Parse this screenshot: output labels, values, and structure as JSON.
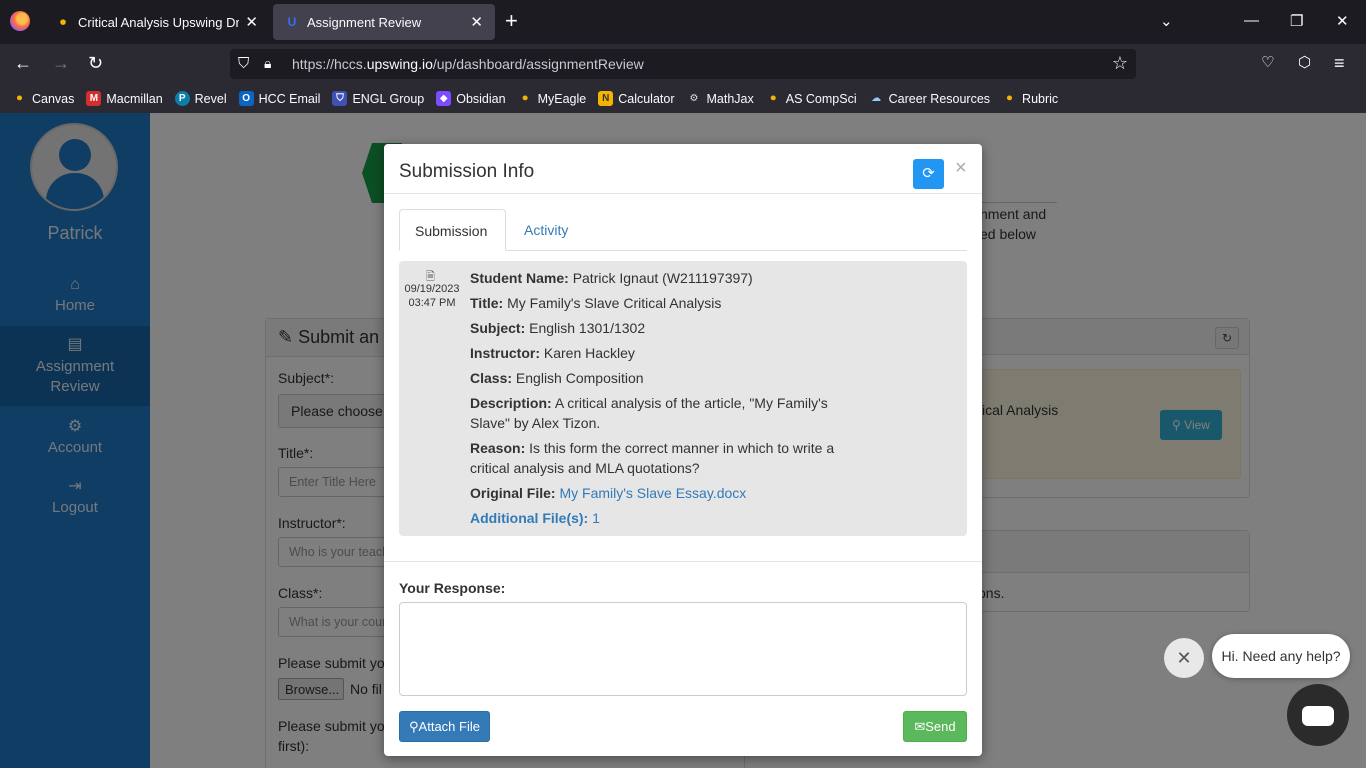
{
  "browser": {
    "tabs": [
      {
        "title": "Critical Analysis Upswing Drafts",
        "active": false
      },
      {
        "title": "Assignment Review",
        "active": true
      }
    ],
    "url_prefix": "https://hccs.",
    "url_domain": "upswing.io",
    "url_path": "/up/dashboard/assignmentReview",
    "bookmarks": [
      "Canvas",
      "Macmillan",
      "Revel",
      "HCC Email",
      "ENGL Group",
      "Obsidian",
      "MyEagle",
      "Calculator",
      "MathJax",
      "AS CompSci",
      "Career Resources",
      "Rubric"
    ]
  },
  "sidebar": {
    "username": "Patrick",
    "items": [
      {
        "label": "Home",
        "icon": "home-icon"
      },
      {
        "label": "Assignment Review",
        "icon": "file-icon",
        "active": true
      },
      {
        "label": "Account",
        "icon": "gear-icon"
      },
      {
        "label": "Logout",
        "icon": "logout-icon"
      }
    ]
  },
  "background": {
    "panel_title": "Submit an",
    "subject_label": "Subject*:",
    "subject_value": "Please choose",
    "title_label": "Title*:",
    "title_placeholder": "Enter Title Here",
    "instructor_label": "Instructor*:",
    "instructor_placeholder": "Who is your teach",
    "class_label": "Class*:",
    "class_placeholder": "What is your cour",
    "file_label": "Please submit yo",
    "browse_label": "Browse...",
    "no_file": "No fil",
    "file2_label": "Please submit yo",
    "file2_sub": "first):",
    "intro_line1": "nment and",
    "intro_line2": "ed below",
    "card_text": "ical Analysis",
    "view_label": "View",
    "panel2_text": "s",
    "panel2_body": "tions."
  },
  "modal": {
    "title": "Submission Info",
    "tabs": [
      "Submission",
      "Activity"
    ],
    "date": "09/19/2023",
    "time": "03:47 PM",
    "fields": {
      "student_name_label": "Student Name:",
      "student_name": "Patrick Ignaut (W211197397)",
      "title_label": "Title:",
      "title": "My Family's Slave Critical Analysis",
      "subject_label": "Subject:",
      "subject": "English 1301/1302",
      "instructor_label": "Instructor:",
      "instructor": "Karen Hackley",
      "class_label": "Class:",
      "class": "English Composition",
      "description_label": "Description:",
      "description": "A critical analysis of the article, \"My Family's Slave\" by Alex Tizon.",
      "reason_label": "Reason:",
      "reason": "Is this form the correct manner in which to write a critical analysis and MLA quotations?",
      "original_file_label": "Original File:",
      "original_file": "My Family's Slave Essay.docx",
      "additional_files_label": "Additional File(s):",
      "additional_files_count": "1"
    },
    "response_label": "Your Response:",
    "attach_label": "Attach File",
    "send_label": "Send"
  },
  "chat": {
    "greeting": "Hi. Need any help?"
  },
  "colors": {
    "sidebar": "#1f7ac8",
    "primary": "#337ab7",
    "success": "#5cb85c",
    "refresh_button": "#2196f3"
  }
}
